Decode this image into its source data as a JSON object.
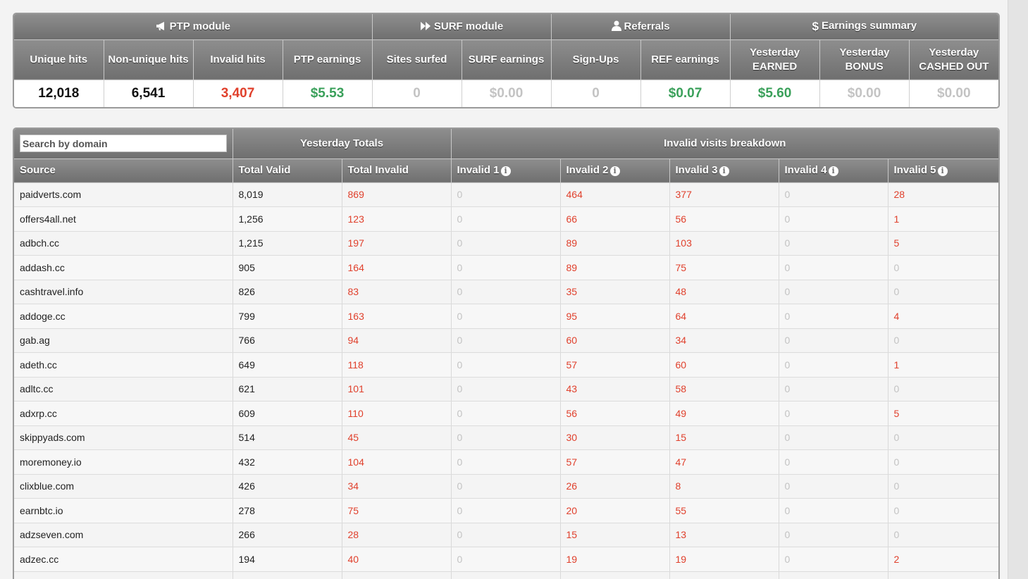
{
  "summary": {
    "groups": [
      {
        "label": "PTP module",
        "icon": "megaphone-icon"
      },
      {
        "label": "SURF module",
        "icon": "fast-forward-icon"
      },
      {
        "label": "Referrals",
        "icon": "user-icon"
      },
      {
        "label": "Earnings summary",
        "icon": "dollar-icon"
      }
    ],
    "columns": [
      "Unique hits",
      "Non-unique hits",
      "Invalid hits",
      "PTP earnings",
      "Sites surfed",
      "SURF earnings",
      "Sign-Ups",
      "REF earnings",
      "Yesterday EARNED",
      "Yesterday BONUS",
      "Yesterday CASHED OUT"
    ],
    "values": [
      "12,018",
      "6,541",
      "3,407",
      "$5.53",
      "0",
      "$0.00",
      "0",
      "$0.07",
      "$5.60",
      "$0.00",
      "$0.00"
    ]
  },
  "sources": {
    "search_placeholder": "Search by domain",
    "group_headers": [
      "Yesterday Totals",
      "Invalid visits breakdown"
    ],
    "columns": [
      "Source",
      "Total Valid",
      "Total Invalid",
      "Invalid 1",
      "Invalid 2",
      "Invalid 3",
      "Invalid 4",
      "Invalid 5"
    ],
    "rows": [
      [
        "paidverts.com",
        "8,019",
        "869",
        "0",
        "464",
        "377",
        "0",
        "28"
      ],
      [
        "offers4all.net",
        "1,256",
        "123",
        "0",
        "66",
        "56",
        "0",
        "1"
      ],
      [
        "adbch.cc",
        "1,215",
        "197",
        "0",
        "89",
        "103",
        "0",
        "5"
      ],
      [
        "addash.cc",
        "905",
        "164",
        "0",
        "89",
        "75",
        "0",
        "0"
      ],
      [
        "cashtravel.info",
        "826",
        "83",
        "0",
        "35",
        "48",
        "0",
        "0"
      ],
      [
        "addoge.cc",
        "799",
        "163",
        "0",
        "95",
        "64",
        "0",
        "4"
      ],
      [
        "gab.ag",
        "766",
        "94",
        "0",
        "60",
        "34",
        "0",
        "0"
      ],
      [
        "adeth.cc",
        "649",
        "118",
        "0",
        "57",
        "60",
        "0",
        "1"
      ],
      [
        "adltc.cc",
        "621",
        "101",
        "0",
        "43",
        "58",
        "0",
        "0"
      ],
      [
        "adxrp.cc",
        "609",
        "110",
        "0",
        "56",
        "49",
        "0",
        "5"
      ],
      [
        "skippyads.com",
        "514",
        "45",
        "0",
        "30",
        "15",
        "0",
        "0"
      ],
      [
        "moremoney.io",
        "432",
        "104",
        "0",
        "57",
        "47",
        "0",
        "0"
      ],
      [
        "clixblue.com",
        "426",
        "34",
        "0",
        "26",
        "8",
        "0",
        "0"
      ],
      [
        "earnbtc.io",
        "278",
        "75",
        "0",
        "20",
        "55",
        "0",
        "0"
      ],
      [
        "adzseven.com",
        "266",
        "28",
        "0",
        "15",
        "13",
        "0",
        "0"
      ],
      [
        "adzec.cc",
        "194",
        "40",
        "0",
        "19",
        "19",
        "0",
        "2"
      ],
      [
        "",
        "",
        "",
        "",
        "",
        "",
        "",
        ""
      ]
    ]
  },
  "colors": {
    "red": "#e0402c",
    "green": "#3aa05a",
    "grey": "#c3c3c3",
    "header": "#7f7f7f"
  }
}
